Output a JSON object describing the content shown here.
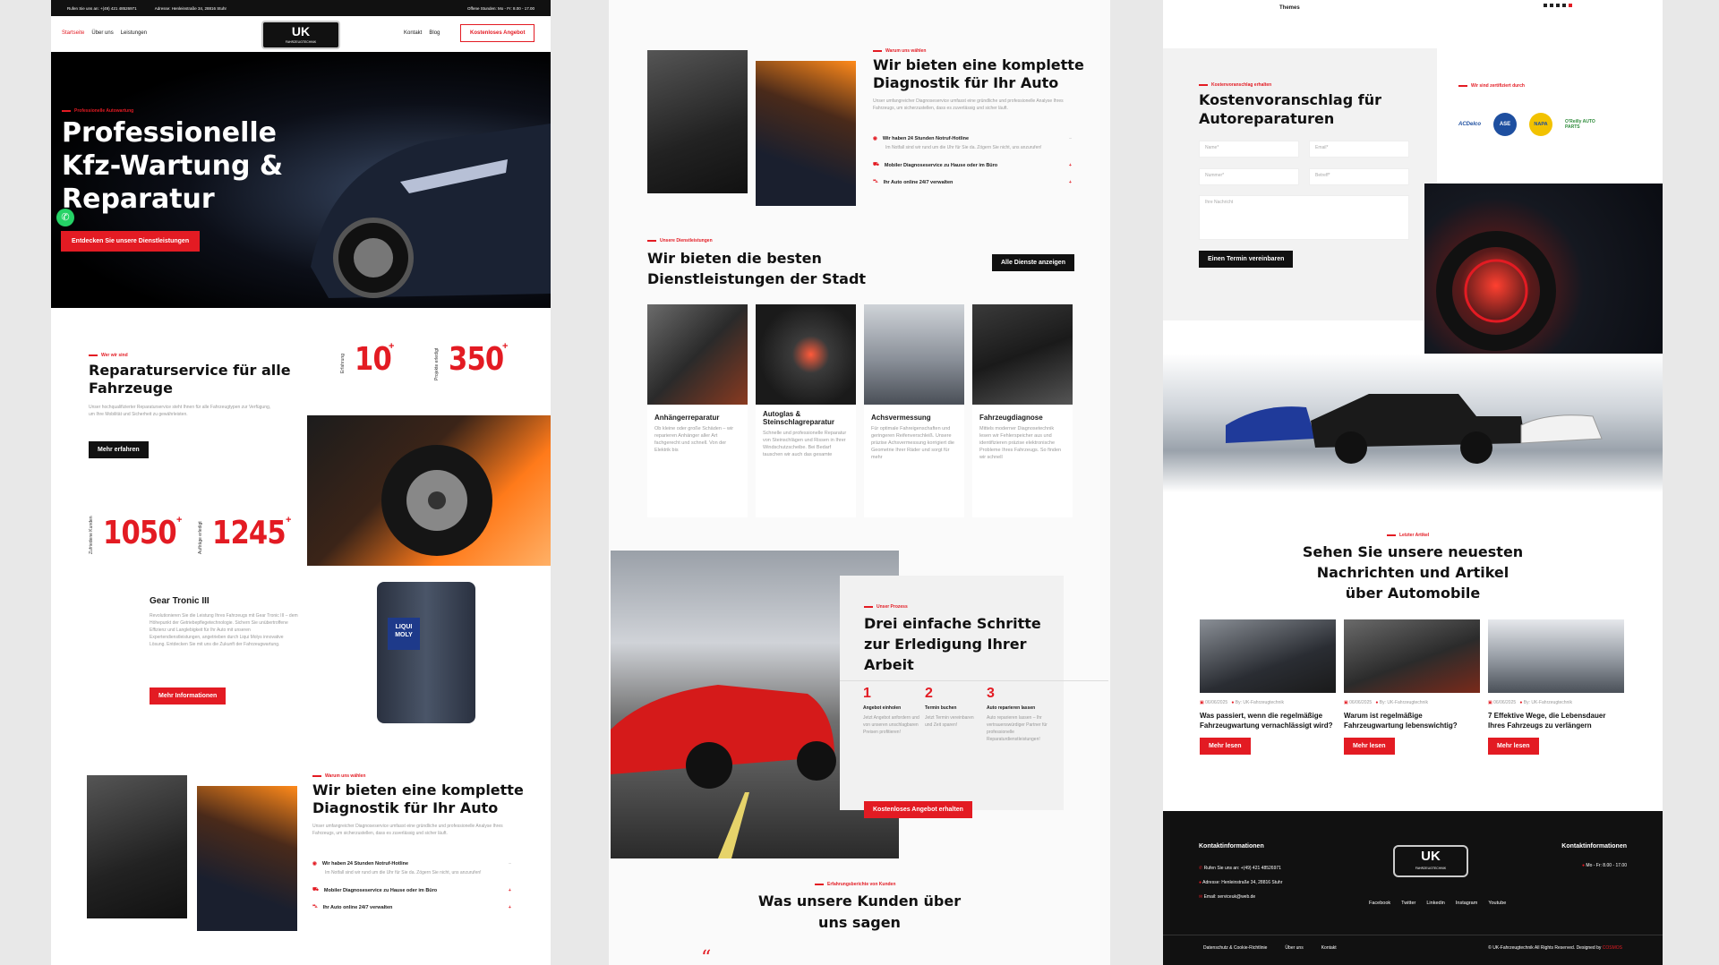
{
  "topbar": {
    "call": "Rufen Sie uns an: +(49) 421 48526971",
    "address": "Adresse: Henleinstraße 34, 28816 Stuhr",
    "hours": "Offene Stunden: Mo - Fr: 8.00 - 17.00"
  },
  "nav": {
    "items": [
      "Startseite",
      "Über uns",
      "Leistungen"
    ],
    "right": [
      "Kontakt",
      "Blog"
    ],
    "cta": "Kostenloses Angebot"
  },
  "hero": {
    "kicker": "Professionelle Autowartung",
    "title_lines": [
      "Professionelle",
      "Kfz-Wartung &",
      "Reparatur"
    ],
    "cta": "Entdecken Sie unsere Dienstleistungen"
  },
  "about": {
    "kicker": "Wer wir sind",
    "title_lines": [
      "Reparaturservice für alle",
      "Fahrzeuge"
    ],
    "text": "Unser hochqualifizierter Reparaturservice steht Ihnen für alle Fahrzeugtypen zur Verfügung, um Ihre Mobilität und Sicherheit zu gewährleisten.",
    "button": "Mehr erfahren"
  },
  "stats": [
    {
      "label": "Erfahrung",
      "value": "10"
    },
    {
      "label": "Projekte erledigt",
      "value": "350"
    },
    {
      "label": "Zufriedene Kunden",
      "value": "1050"
    },
    {
      "label": "Aufträge erledigt",
      "value": "1245"
    }
  ],
  "gear": {
    "title": "Gear Tronic III",
    "text": "Revolutionieren Sie die Leistung Ihres Fahrzeugs mit Gear Tronic III – dem Höhepunkt der Getriebepflegetechnologie. Sichern Sie unübertroffene Effizienz und Langlebigkeit für Ihr Auto mit unseren Expertendienstleistungen, angetrieben durch Liqui Molys innovative Lösung. Entdecken Sie mit uns die Zukunft der Fahrzeugwartung.",
    "button": "Mehr Informationen",
    "brand": "LIQUI MOLY"
  },
  "diag": {
    "kicker": "Warum uns wählen",
    "title_lines": [
      "Wir bieten eine komplette",
      "Diagnostik für Ihr Auto"
    ],
    "text": "Unser umfangreicher Diagnoseservice umfasst eine gründliche und professionelle Analyse Ihres Fahrzeugs, um sicherzustellen, dass es zuverlässig und sicher läuft.",
    "items": [
      {
        "label": "Wir haben 24 Stunden Notruf-Hotline",
        "sub": "Im Notfall sind wir rund um die Uhr für Sie da. Zögern Sie nicht, uns anzurufen!"
      },
      {
        "label": "Mobiler Diagnoseservice zu Hause oder im Büro",
        "sub": ""
      },
      {
        "label": "Ihr Auto online 24/7 verwalten",
        "sub": ""
      }
    ]
  },
  "services": {
    "kicker": "Unsere Dienstleistungen",
    "title_lines": [
      "Wir bieten die besten",
      "Dienstleistungen der Stadt"
    ],
    "button": "Alle Dienste anzeigen",
    "items": [
      {
        "title": "Anhängerreparatur",
        "text": "Ob kleine oder große Schäden – wir reparieren Anhänger aller Art fachgerecht und schnell. Von der Elektrik bis"
      },
      {
        "title": "Autoglas & Steinschlagreparatur",
        "text": "Schnelle und professionelle Reparatur von Steinschlägen und Rissen in Ihrer Windschutzscheibe. Bei Bedarf tauschen wir auch das gesamte"
      },
      {
        "title": "Achsvermessung",
        "text": "Für optimale Fahreigenschaften und geringeren Reifenverschleiß. Unsere präzise Achsvermessung korrigiert die Geometrie Ihrer Räder und sorgt für mehr"
      },
      {
        "title": "Fahrzeugdiagnose",
        "text": "Mittels moderner Diagnosetechnik lesen wir Fehlerspeicher aus und identifizieren präzise elektronische Probleme Ihres Fahrzeugs. So finden wir schnell"
      }
    ]
  },
  "process": {
    "kicker": "Unser Prozess",
    "title_lines": [
      "Drei einfache Schritte",
      "zur Erledigung Ihrer",
      "Arbeit"
    ],
    "steps": [
      {
        "n": "1",
        "title": "Angebot einholen",
        "text": "Jetzt Angebot anfordern und von unseren unschlagbaren Preisen profitieren!"
      },
      {
        "n": "2",
        "title": "Termin buchen",
        "text": "Jetzt Termin vereinbaren und Zeit sparen!"
      },
      {
        "n": "3",
        "title": "Auto reparieren lassen",
        "text": "Auto reparieren lassen – Ihr vertrauenswürdiger Partner für professionelle Reparaturdienstleistungen!"
      }
    ],
    "button": "Kostenloses Angebot erhalten"
  },
  "reviews": {
    "kicker": "Erfahrungsberichte von Kunden",
    "title_lines": [
      "Was unsere Kunden über",
      "uns sagen"
    ]
  },
  "themes_label": "Themes",
  "quote": {
    "kicker": "Kostenvoranschlag erhalten",
    "title_lines": [
      "Kostenvoranschlag für",
      "Autoreparaturen"
    ],
    "fields": {
      "name": "Name*",
      "email": "Email*",
      "number": "Nummer*",
      "subject": "Betreff*",
      "message": "Ihre Nachricht"
    },
    "button": "Einen Termin vereinbaren"
  },
  "certified": {
    "kicker": "Wir sind zertifiziert durch",
    "brands": [
      "ACDelco",
      "ASE",
      "NAPA",
      "O'Reilly AUTO PARTS"
    ]
  },
  "news": {
    "kicker": "Letzter Artikel",
    "title_lines": [
      "Sehen Sie unsere neuesten",
      "Nachrichten und Artikel",
      "über Automobile"
    ],
    "items": [
      {
        "date": "06/06/2025",
        "author": "By: UK-Fahrzeugtechnik",
        "title": "Was passiert, wenn die regelmäßige Fahrzeugwartung vernachlässigt wird?",
        "button": "Mehr lesen"
      },
      {
        "date": "06/06/2025",
        "author": "By: UK-Fahrzeugtechnik",
        "title": "Warum ist regelmäßige Fahrzeugwartung lebenswichtig?",
        "button": "Mehr lesen"
      },
      {
        "date": "06/06/2025",
        "author": "By: UK-Fahrzeugtechnik",
        "title": "7 Effektive Wege, die Lebensdauer Ihres Fahrzeugs zu verlängern",
        "button": "Mehr lesen"
      }
    ]
  },
  "footer": {
    "left_title": "Kontaktinformationen",
    "call": "Rufen Sie uns an: +(49) 421 48526971",
    "address": "Adresse: Henleinstraße 34, 28816 Stuhr",
    "email": "Email: serviceuk@web.de",
    "right_title": "Kontaktinformationen",
    "hours": "Mo - Fr: 8.00 - 17.00",
    "social": [
      "Facebook",
      "Twitter",
      "Linkedin",
      "Instagram",
      "Youtube"
    ],
    "links": [
      "Datenschutz & Cookie-Richtlinie",
      "Über uns",
      "Kontakt"
    ],
    "copyright": "© UK-Fahrzeugtechnik All Rights Reserved. Designed by",
    "designer": "COSMOS"
  },
  "logo": {
    "text": "UK",
    "sub": "FAHRZEUGTECHNIK"
  },
  "colors": {
    "accent": "#e31b23",
    "dark": "#111111"
  }
}
